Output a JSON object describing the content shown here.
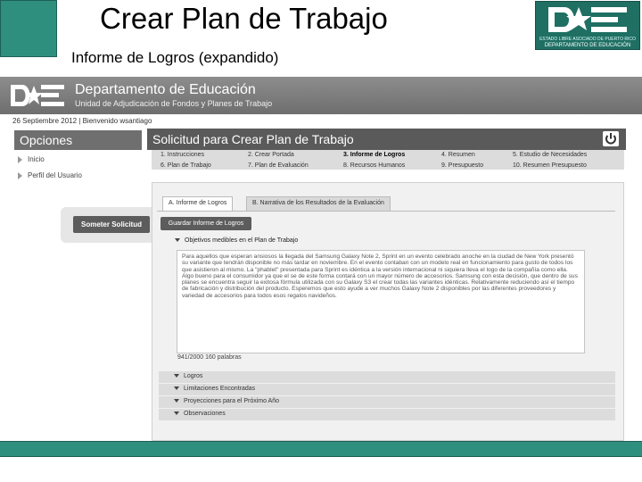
{
  "slide": {
    "title": "Crear Plan de Trabajo",
    "subtitle": "Informe de Logros (expandido)",
    "corner_logo": {
      "line1": "ESTADO LIBRE ASOCIADO DE PUERTO RICO",
      "line2": "DEPARTAMENTO DE EDUCACIÓN"
    },
    "accent_color": "#2f8f7f"
  },
  "app": {
    "banner": {
      "title": "Departamento de Educación",
      "subtitle": "Unidad de Adjudicación de Fondos y Planes de Trabajo"
    },
    "date_line": "26 Septiembre 2012 | Bienvenido wsantiago",
    "sidebar": {
      "heading": "Opciones",
      "items": [
        {
          "label": "Inicio"
        },
        {
          "label": "Perfil del Usuario"
        }
      ],
      "submit_label": "Someter Solicitud"
    },
    "main": {
      "heading": "Solicitud para Crear Plan de Trabajo",
      "power_icon": "power-icon",
      "steps": [
        {
          "label": "1. Instrucciones"
        },
        {
          "label": "2. Crear Portada"
        },
        {
          "label": "3. Informe de Logros"
        },
        {
          "label": "4. Resumen"
        },
        {
          "label": "5. Estudio de Necesidades"
        },
        {
          "label": "6. Plan de Trabajo"
        },
        {
          "label": "7. Plan de Evaluación"
        },
        {
          "label": "8. Recursos Humanos"
        },
        {
          "label": "9. Presupuesto"
        },
        {
          "label": "10. Resumen Presupuesto"
        }
      ],
      "active_step": 2,
      "tabs": [
        {
          "label": "A. Informe de Logros"
        },
        {
          "label": "B. Narrativa de los Resultados de la Evaluación"
        }
      ],
      "save_label": "Guardar Informe de Logros",
      "section_label": "Objetivos medibles en el Plan de Trabajo",
      "text_value": "Para aquellos que esperan ansiosos la llegada del Samsung Galaxy Note 2, Sprint en un evento celebrado anoche en la ciudad de New York presentó su variante que tendrán disponible no más tardar en noviembre. En el evento contaban con un modelo real en funcionamiento para gusto de todos los que asistieron al mismo. La \"phablet\" presentada para Sprint es idéntica a la versión internacional ni siquiera lleva el logo de la compañía como ella. Algo bueno para el consumidor ya que el se de este forma contará con un mayor número de accesorios. Samsung con esta decisión, que dentro de sus planes se encuentra seguir la exitosa fórmula utilizada con su Galaxy S3 el crear todas las variantes idénticas. Relativamente reduciendo así el tiempo de fabricación y distribución del producto. Esperemos que esto ayude a ver muchos Galaxy Note 2 disponibles por las diferentes proveedores y variedad de accesorios para todos esos regalos navideños.",
      "counter": "941/2000 160 palabras",
      "accordion": [
        {
          "label": "Logros"
        },
        {
          "label": "Limitaciones Encontradas"
        },
        {
          "label": "Proyecciones para el Próximo Año"
        },
        {
          "label": "Observaciones"
        }
      ]
    }
  }
}
